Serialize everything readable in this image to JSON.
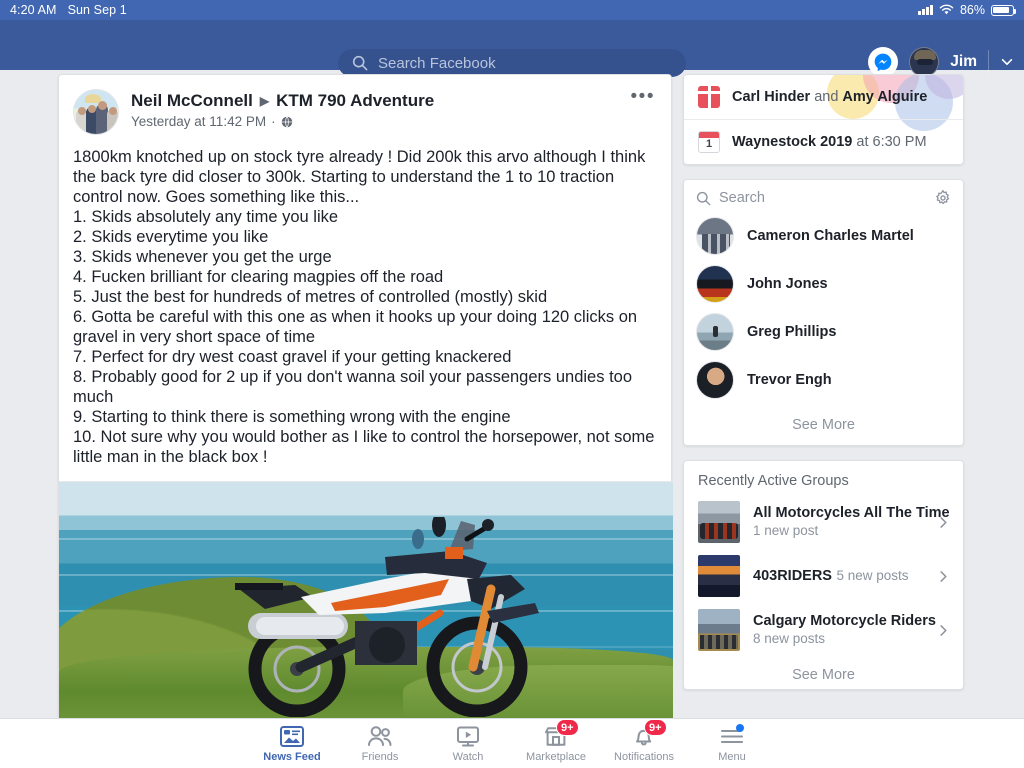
{
  "statusbar": {
    "time": "4:20 AM",
    "date": "Sun Sep 1",
    "battery_percent": "86%",
    "wifi_icon": "wifi-icon",
    "signal_icon": "cellular-signal-icon",
    "battery_icon": "battery-icon"
  },
  "header": {
    "search_placeholder": "Search Facebook",
    "search_icon": "search-icon",
    "messenger_icon": "messenger-icon",
    "account_name": "Jim",
    "chevron_icon": "chevron-down-icon",
    "brand_color": "#3b5a9b"
  },
  "post": {
    "author": "Neil McConnell",
    "group": "KTM 790 Adventure",
    "caret_icon": "caret-right-icon",
    "timestamp": "Yesterday at 11:42 PM",
    "separator": "·",
    "privacy_icon": "globe-icon",
    "menu_icon": "ellipsis-icon",
    "menu_label": "•••",
    "body": "1800km knotched up on stock tyre already ! Did 200k this arvo although I think the back tyre did closer to 300k. Starting to understand the 1 to 10 traction control now. Goes something like this...\n1. Skids absolutely any time you like\n2. Skids everytime you like\n3. Skids whenever you get the urge\n4. Fucken brilliant for clearing magpies off the road\n5. Just the best for hundreds of metres of controlled (mostly) skid\n6. Gotta be careful with this one as when it hooks up your doing 120 clicks on gravel in very short space of time\n7. Perfect for dry west coast gravel if your getting knackered\n8. Probably good for 2 up if you don't wanna soil your passengers undies too much\n9. Starting to think there is something wrong with the engine\n10. Not sure why you would bother as I like to control the horsepower, not some little man in the black box !",
    "photo_alt": "KTM 790 Adventure motorcycle parked on a grassy coastal cliff above the ocean"
  },
  "rail": {
    "birthday_card": {
      "birthday_icon": "gift-icon",
      "birthday_names": "Carl Hinder",
      "birthday_conjunction": " and ",
      "birthday_names2": "Amy Alguire",
      "event_icon": "calendar-icon",
      "event_day": "1",
      "event_name": "Waynestock 2019",
      "event_time": " at 6:30 PM"
    },
    "contacts": {
      "search_placeholder": "Search",
      "search_icon": "search-icon",
      "settings_icon": "gear-icon",
      "items": [
        {
          "name": "Cameron Charles Martel"
        },
        {
          "name": "John Jones"
        },
        {
          "name": "Greg Phillips"
        },
        {
          "name": "Trevor Engh"
        }
      ],
      "see_more": "See More"
    },
    "groups": {
      "title": "Recently Active Groups",
      "items": [
        {
          "name": "All Motorcycles All The Time",
          "sub": "1 new post",
          "chevron": "chevron-right-icon"
        },
        {
          "name": "403RIDERS",
          "sub": "5 new posts",
          "chevron": "chevron-right-icon"
        },
        {
          "name": "Calgary Motorcycle Riders",
          "sub": "8 new posts",
          "chevron": "chevron-right-icon"
        }
      ],
      "see_more": "See More"
    }
  },
  "tabbar": {
    "items": [
      {
        "label": "News Feed",
        "icon": "news-feed-icon",
        "badge": "",
        "active": true
      },
      {
        "label": "Friends",
        "icon": "friends-icon",
        "badge": "",
        "active": false
      },
      {
        "label": "Watch",
        "icon": "watch-video-icon",
        "badge": "",
        "active": false
      },
      {
        "label": "Marketplace",
        "icon": "marketplace-icon",
        "badge": "9+",
        "active": false
      },
      {
        "label": "Notifications",
        "icon": "bell-icon",
        "badge": "9+",
        "active": false
      },
      {
        "label": "Menu",
        "icon": "hamburger-menu-icon",
        "badge": "",
        "active": false
      }
    ],
    "badge_color": "#f02849",
    "active_color": "#4267b2"
  }
}
